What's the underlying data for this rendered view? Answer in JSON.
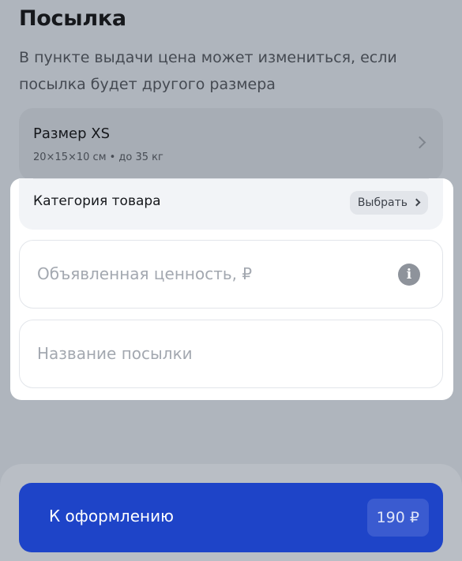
{
  "header": {
    "title": "Посылка",
    "subtitle": "В пункте выдачи цена может измениться, если посылка будет другого размера"
  },
  "size": {
    "title": "Размер XS",
    "details": "20×15×10 см • до 35 кг",
    "chevron_icon": "chevron-right-icon"
  },
  "category": {
    "label": "Категория товара",
    "button_label": "Выбрать"
  },
  "fields": {
    "declared_value_placeholder": "Объявленная ценность, ₽",
    "declared_value_icon": "info-icon",
    "parcel_name_placeholder": "Название посылки"
  },
  "checkout": {
    "label": "К оформлению",
    "price": "190 ₽"
  },
  "colors": {
    "accent": "#1e44c8",
    "overlay": "#afb5bd",
    "highlight": "#ffffff"
  }
}
